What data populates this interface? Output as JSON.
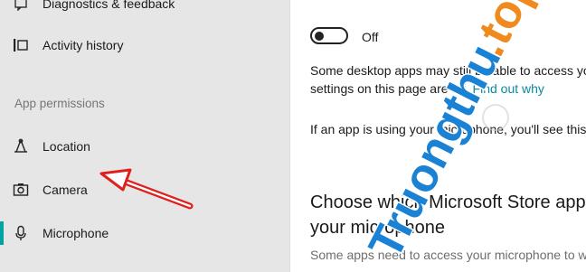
{
  "sidebar": {
    "items_top": [
      {
        "label": "Diagnostics & feedback",
        "icon": "feedback-icon"
      },
      {
        "label": "Activity history",
        "icon": "timeline-icon"
      }
    ],
    "section_header": "App permissions",
    "items": [
      {
        "label": "Location",
        "icon": "location-icon"
      },
      {
        "label": "Camera",
        "icon": "camera-icon"
      },
      {
        "label": "Microphone",
        "icon": "microphone-icon",
        "selected": true
      }
    ]
  },
  "content": {
    "toggle": {
      "state": "Off"
    },
    "para1_line1": "Some desktop apps may still be able to access yo",
    "para1_line2": "settings on this page are off.",
    "find_out_why": "Find out why",
    "para2": "If an app is using your microphone, you'll see this",
    "heading_line1": "Choose which Microsoft Store app",
    "heading_line2": "your microphone",
    "sub_line1": "Some apps need to access your microphone to w"
  },
  "annotation": {
    "arrow_color": "#e0201c"
  },
  "watermark": {
    "text": "Truongthu.top",
    "color": "#1a82d4"
  },
  "colors": {
    "accent": "#00a3a3",
    "sidebar_bg": "#e6e6e6"
  }
}
